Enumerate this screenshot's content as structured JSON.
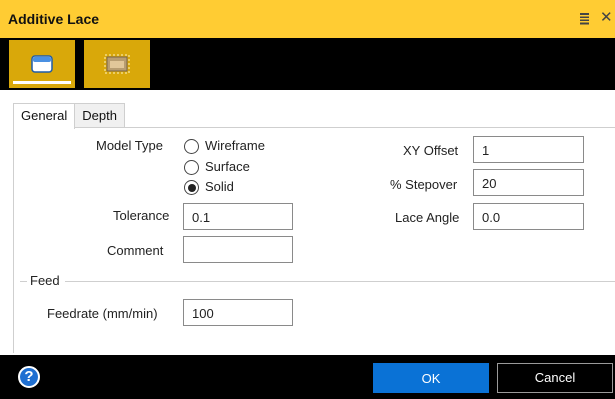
{
  "window": {
    "title": "Additive Lace"
  },
  "colors": {
    "accent": "#ffcc33",
    "ribbon_button": "#d9a80a",
    "primary_button": "#0a72d6",
    "help_icon": "#1f6fd1"
  },
  "ribbon": {
    "buttons": [
      {
        "icon": "solid-model-icon",
        "active": true
      },
      {
        "icon": "boundary-box-icon",
        "active": false
      }
    ]
  },
  "tabs": [
    {
      "label": "General",
      "active": true
    },
    {
      "label": "Depth",
      "active": false
    }
  ],
  "general": {
    "model_type": {
      "label": "Model Type",
      "options": [
        {
          "label": "Wireframe",
          "checked": false
        },
        {
          "label": "Surface",
          "checked": false
        },
        {
          "label": "Solid",
          "checked": true
        }
      ]
    },
    "tolerance": {
      "label": "Tolerance",
      "value": "0.1"
    },
    "comment": {
      "label": "Comment",
      "value": ""
    },
    "xy_offset": {
      "label": "XY Offset",
      "value": "1"
    },
    "stepover": {
      "label": "% Stepover",
      "value": "20"
    },
    "lace_angle": {
      "label": "Lace Angle",
      "value": "0.0"
    }
  },
  "feed": {
    "group_label": "Feed",
    "feedrate": {
      "label": "Feedrate (mm/min)",
      "value": "100"
    }
  },
  "footer": {
    "help_symbol": "?",
    "ok_label": "OK",
    "cancel_label": "Cancel"
  }
}
